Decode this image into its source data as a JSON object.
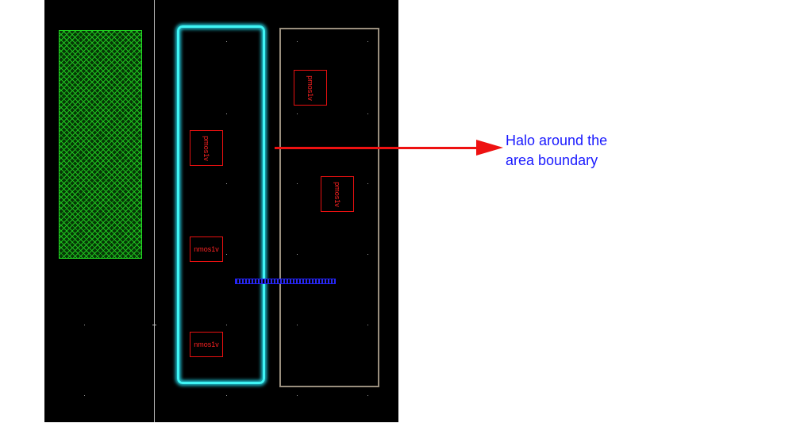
{
  "annotation": {
    "line1": "Halo around the",
    "line2": "area boundary"
  },
  "cells": {
    "halo_top": "pmos1v",
    "halo_mid": "nmos1v",
    "halo_bottom": "nmos1v",
    "right_top": "pmos1v",
    "right_mid": "pmos1v"
  },
  "colors": {
    "canvas_background": "#000000",
    "halo": "#3ff4f4",
    "cell_outline": "#e81010",
    "fill_pattern": "#1fbf1f",
    "area_boundary": "#9a8f7e",
    "arrow": "#ee1111",
    "annotation_text": "#1a1aff"
  }
}
